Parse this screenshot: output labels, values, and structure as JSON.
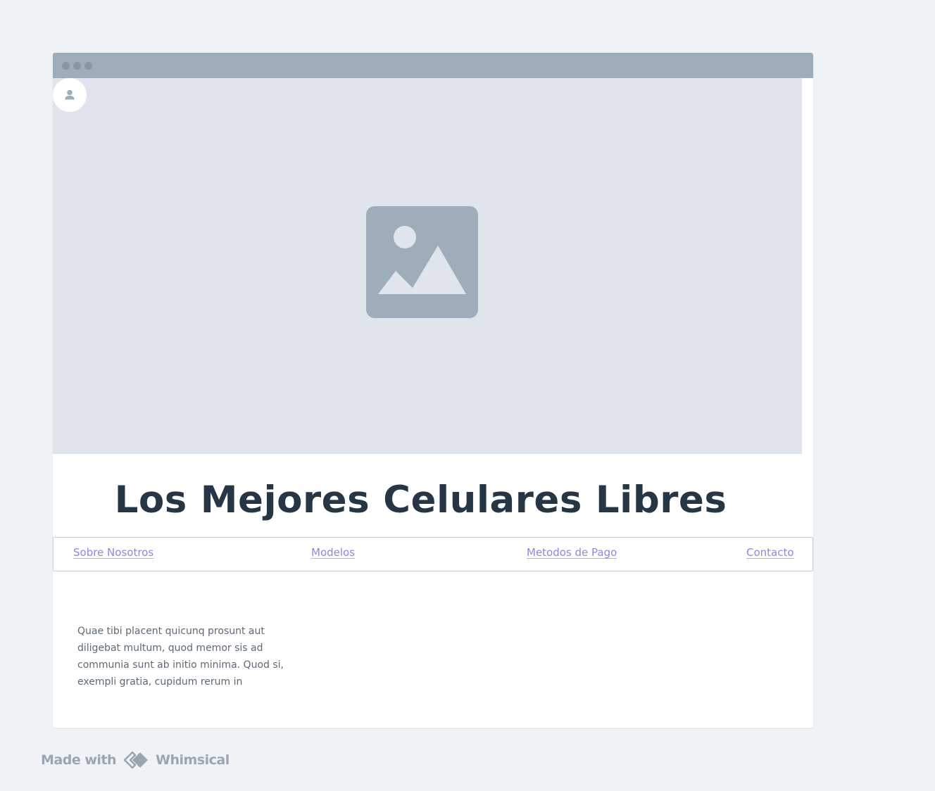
{
  "page": {
    "title": "Los Mejores Celulares Libres",
    "body_text": "Quae tibi placent quicunq prosunt aut diligebat multum, quod memor sis ad communia sunt ab initio minima. Quod si, exempli gratia, cupidum rerum in"
  },
  "nav": {
    "items": [
      {
        "label": "Sobre Nosotros"
      },
      {
        "label": "Modelos"
      },
      {
        "label": "Metodos de Pago"
      },
      {
        "label": "Contacto"
      }
    ]
  },
  "footer": {
    "made_with": "Made with",
    "brand": "Whimsical"
  },
  "icons": {
    "avatar": "user-icon",
    "hero": "image-placeholder-icon",
    "footer_logo": "whimsical-logo-icon"
  },
  "colors": {
    "background": "#eff3f6",
    "titlebar": "#9eadba",
    "placeholder": "#e0e5ed",
    "link": "#8f86dd",
    "title": "#263645"
  }
}
